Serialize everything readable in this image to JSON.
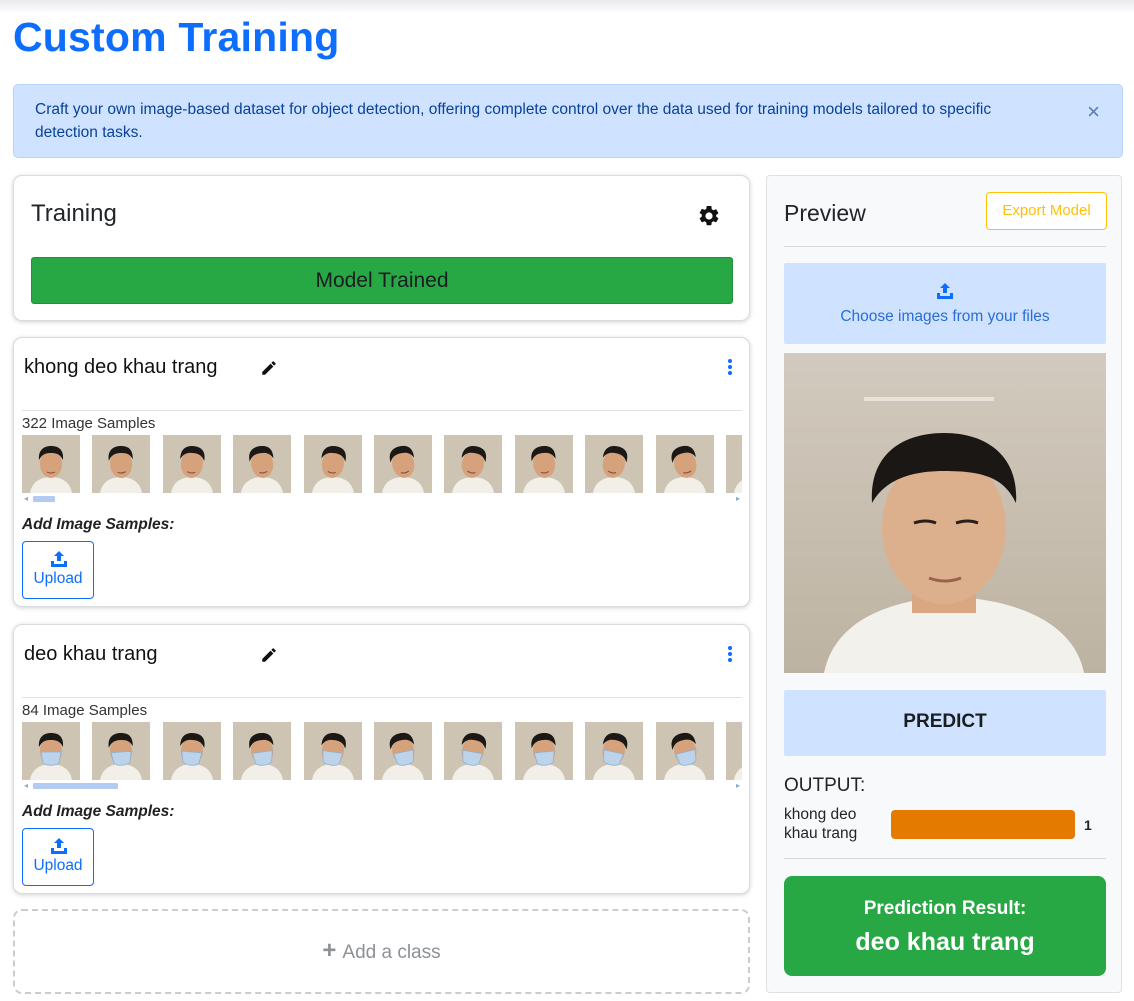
{
  "page": {
    "title": "Custom Training",
    "info_alert": "Craft your own image-based dataset for object detection, offering complete control over the data used for training models tailored to specific detection tasks.",
    "close_glyph": "×"
  },
  "training": {
    "title": "Training",
    "status_button": "Model Trained"
  },
  "classes": [
    {
      "name": "khong deo khau trang",
      "sample_count": "322 Image Samples",
      "add_label": "Add Image Samples:",
      "upload_label": "Upload",
      "mask": false
    },
    {
      "name": "deo khau trang",
      "sample_count": "84 Image Samples",
      "add_label": "Add Image Samples:",
      "upload_label": "Upload",
      "mask": true
    }
  ],
  "add_class": {
    "plus": "+",
    "label": "Add a class"
  },
  "preview": {
    "title": "Preview",
    "export_label": "Export Model",
    "choose_label": "Choose images from your files",
    "predict_label": "PREDICT",
    "output_label": "OUTPUT:",
    "output": [
      {
        "class": "khong deo khau trang",
        "value": "1",
        "fraction": 1.0
      }
    ],
    "result_heading": "Prediction Result:",
    "result_class": "deo khau trang"
  },
  "colors": {
    "primary": "#0d6efd",
    "success": "#28a745",
    "warning": "#ffc107",
    "output_bar": "#e47a00",
    "alert_bg": "#cfe2ff"
  },
  "icons": [
    "gear-icon",
    "pencil-icon",
    "kebab-menu-icon",
    "upload-icon",
    "close-icon",
    "plus-icon"
  ]
}
